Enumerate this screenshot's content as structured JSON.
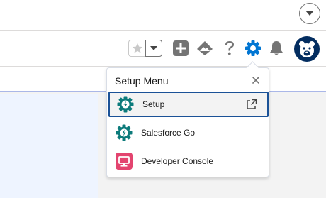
{
  "colors": {
    "brand_blue": "#0176d3",
    "navy": "#032d60",
    "icon_gray": "#747474",
    "menu_icon_teal": "#0c7b7b",
    "console_pink": "#e3446f",
    "focus_border": "#1b5297"
  },
  "topbar": {
    "dropdown_icon": "chevron-down-icon"
  },
  "header": {
    "icons": [
      "star-icon",
      "chevron-down-icon",
      "plus-icon",
      "trailhead-icon",
      "help-icon",
      "gear-icon",
      "bell-icon",
      "bear-avatar-icon"
    ]
  },
  "setup_menu": {
    "title": "Setup Menu",
    "close_icon": "close-icon",
    "items": [
      {
        "label": "Setup",
        "icon": "gear-icon",
        "trailing_icon": "external-link-icon",
        "selected": true
      },
      {
        "label": "Salesforce Go",
        "icon": "gear-icon",
        "selected": false
      },
      {
        "label": "Developer Console",
        "icon": "console-icon",
        "selected": false
      }
    ]
  }
}
